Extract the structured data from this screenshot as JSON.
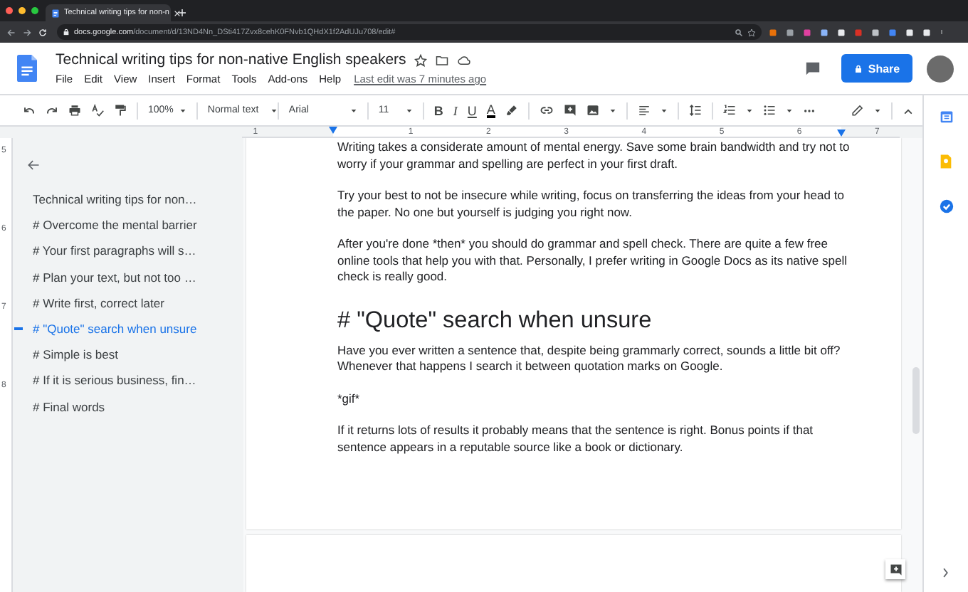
{
  "browser": {
    "tab_title": "Technical writing tips for non-n",
    "url_host": "docs.google.com",
    "url_path": "/document/d/13ND4Nn_DSti417Zvx8cehK0FNvb1QHdX1f2AdUJu708/edit#"
  },
  "doc": {
    "title": "Technical writing tips for non-native English speakers",
    "menus": [
      "File",
      "Edit",
      "View",
      "Insert",
      "Format",
      "Tools",
      "Add-ons",
      "Help"
    ],
    "last_edit": "Last edit was 7 minutes ago",
    "share": "Share"
  },
  "toolbar": {
    "zoom": "100%",
    "style": "Normal text",
    "font": "Arial",
    "size": "11",
    "format": [
      "B",
      "I",
      "U",
      "A"
    ]
  },
  "ruler": {
    "horizontal": [
      "1",
      "1",
      "2",
      "3",
      "4",
      "5",
      "6",
      "7"
    ],
    "vertical": [
      "5",
      "6",
      "7",
      "8"
    ]
  },
  "outline": {
    "items": [
      {
        "text": "Technical writing tips for non…",
        "selected": false
      },
      {
        "text": "# Overcome the mental barrier",
        "selected": false
      },
      {
        "text": "# Your first paragraphs will s…",
        "selected": false
      },
      {
        "text": "# Plan your text, but not too …",
        "selected": false
      },
      {
        "text": "# Write first, correct later",
        "selected": false
      },
      {
        "text": "# \"Quote\" search when unsure",
        "selected": true
      },
      {
        "text": "# Simple is best",
        "selected": false
      },
      {
        "text": "# If it is serious business, fin…",
        "selected": false
      },
      {
        "text": "# Final words",
        "selected": false
      }
    ]
  },
  "body": [
    {
      "kind": "paragraph",
      "text": "Writing takes a considerate amount of mental energy. Save some brain bandwidth and try not to worry if your grammar and spelling are perfect in your first draft."
    },
    {
      "kind": "paragraph",
      "text": "Try your best to not be insecure while writing, focus on transferring the ideas from your head to the paper. No one but yourself is judging you right now."
    },
    {
      "kind": "paragraph",
      "text": "After you're done *then* you should do grammar and spell check. There are quite a few free online tools that help you with that. Personally, I prefer writing in Google Docs as its native spell check is really good."
    },
    {
      "kind": "heading",
      "text": "# \"Quote\" search when unsure"
    },
    {
      "kind": "paragraph",
      "text": "Have you ever written a sentence that, despite being grammarly correct, sounds a little bit off? Whenever that happens I search it between quotation marks on Google."
    },
    {
      "kind": "paragraph",
      "text": "*gif*"
    },
    {
      "kind": "paragraph",
      "text": "If it returns lots of results it probably means that the sentence is right. Bonus points if that sentence appears in a reputable source like a book or dictionary."
    }
  ]
}
